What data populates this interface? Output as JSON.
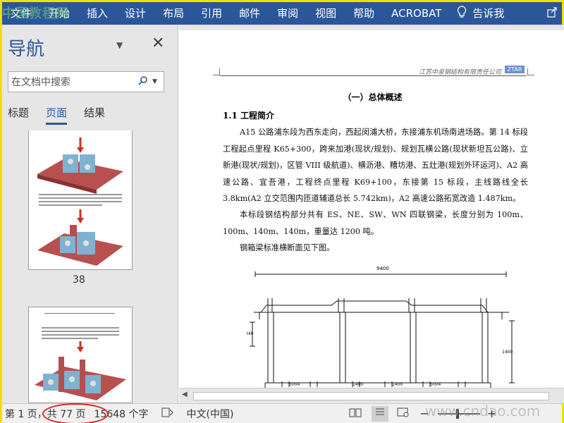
{
  "ribbon": {
    "tabs": [
      "文件",
      "开始",
      "插入",
      "设计",
      "布局",
      "引用",
      "邮件",
      "审阅",
      "视图",
      "帮助",
      "ACROBAT"
    ],
    "tell_me": "告诉我"
  },
  "watermark_top": "中国教程网",
  "nav": {
    "title": "导航",
    "search_placeholder": "在文档中搜索",
    "tabs": [
      "标题",
      "页面",
      "结果"
    ],
    "active_tab": "页面",
    "thumbnail_page": "38"
  },
  "document": {
    "header_company": "江苏中泉钢结构有限责任公司",
    "header_logo": "ZTAR",
    "title": "（一）总体概述",
    "heading": "1.1 工程简介",
    "paragraphs": [
      "A15 公路浦东段为西东走向，西起闵浦大桥，东接浦东机场南进场路。第 14 标段工程起点里程 K65+300，跨来加港(现状/规划)、规划瓦横公路(现状新坦瓦公路)、立新港(现状/规划)，区管 VIII 级航道)、横沥港、糟坊港、五灶港(规划外环运河)、A2 高速公路、宜吾港，工程终点里程 K69+100，东接第 15 标段，主线路线全长 3.8km(A2 立交范围内匝道辅道总长 5.742km)，A2 高速公路拓宽改造 1.487km。",
      "本标段钢结构部分共有 ES、NE、SW、WN 四联钢梁，长度分别为 100m、100m、140m、140m，重量达 1200 吨。",
      "钢箱梁标准横断面见下图。"
    ],
    "drawing_dims": [
      "9400",
      "5004",
      "5004",
      "1400",
      "1400",
      "3200",
      "1000",
      "1000",
      "3200",
      "340",
      "1400"
    ]
  },
  "status": {
    "page": "第 1 页，",
    "total": "共 77 页",
    "words": "15648 个字",
    "language": "中文(中国)"
  },
  "watermark_bottom": "www.cndao.com"
}
